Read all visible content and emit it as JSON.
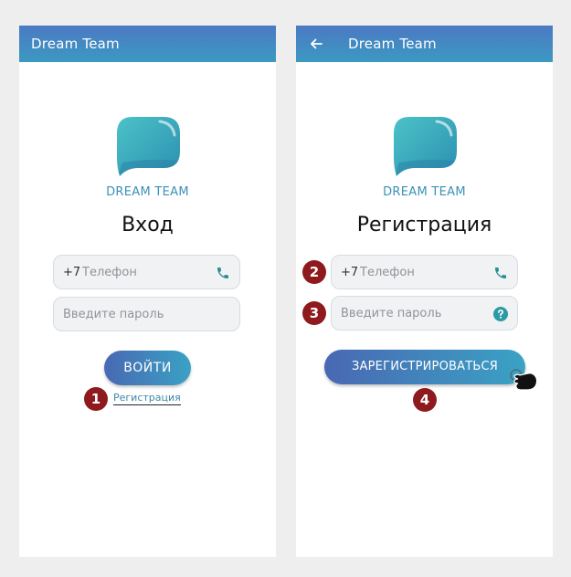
{
  "login": {
    "app_title": "Dream Team",
    "brand": "DREAM TEAM",
    "heading": "Вход",
    "phone_prefix": "+7",
    "phone_placeholder": "Телефон",
    "password_placeholder": "Введите пароль",
    "login_button": "ВОЙТИ",
    "register_link": "Регистрация"
  },
  "register": {
    "app_title": "Dream Team",
    "brand": "DREAM TEAM",
    "heading": "Регистрация",
    "phone_prefix": "+7",
    "phone_placeholder": "Телефон",
    "password_placeholder": "Введите пароль",
    "register_button": "ЗАРЕГИСТРИРОВАТЬСЯ"
  },
  "steps": [
    "1",
    "2",
    "3",
    "4"
  ],
  "icons": {
    "back": "back-arrow-icon",
    "phone": "phone-icon",
    "help": "question-icon",
    "logo": "speech-bubble-logo",
    "cursor": "hand-pointer-icon"
  },
  "colors": {
    "app_bar_top": "#4b79c3",
    "app_bar_bottom": "#3c99c2",
    "accent": "#3a91b8",
    "step_badge": "#8e1a1d"
  }
}
